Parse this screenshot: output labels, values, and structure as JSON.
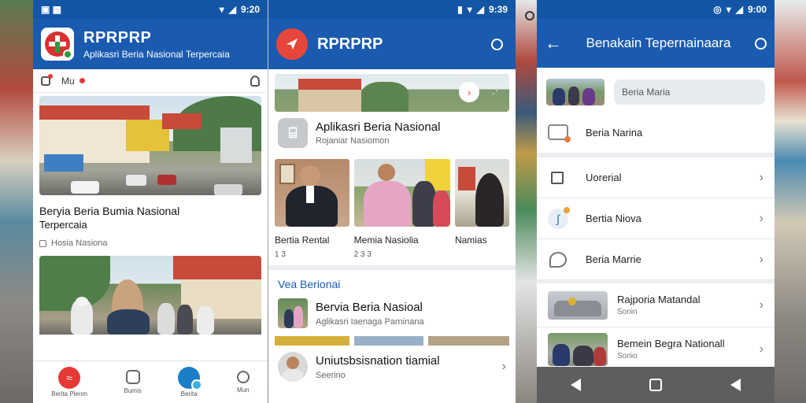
{
  "status": {
    "left_icons": "▣ ▩",
    "time1": "9:20",
    "time2": "9:39",
    "time3": "9:00"
  },
  "screen1": {
    "app_name": "RPRPRP",
    "app_tagline": "Aplikasri Beria Nasional Terpercaia",
    "tab_label": "Mu",
    "card1_title": "Beryia Beria Bumia Nasional",
    "card1_subtitle": "Terpercaia",
    "card1_meta": "Hosia Nasiona",
    "bottom_nav": [
      "Berita Plenm",
      "Bumis",
      "Berita",
      "Mun"
    ]
  },
  "screen2": {
    "app_name": "RPRPRP",
    "feature_title": "Aplikasri Beria Nasional",
    "feature_sub": "Rojaniar Nasiomon",
    "gallery": [
      {
        "title": "Bertia Rental",
        "meta": "1 3"
      },
      {
        "title": "Memia Nasiolia",
        "meta": "2 3 3"
      },
      {
        "title": "Namias",
        "meta": ""
      }
    ],
    "section_label": "Vea Berionai",
    "items": [
      {
        "title": "Bervia Beria Nasioal",
        "sub": "Aglikasri Iaenaga Parninana"
      },
      {
        "title": "Uniutsbsisnation tiamial",
        "sub": "Seerino"
      }
    ]
  },
  "screen3": {
    "title": "Benakain Tepernainaara",
    "items": [
      {
        "label": "Beria Maria"
      },
      {
        "label": "Beria Narina"
      },
      {
        "label": "Uorerial"
      },
      {
        "label": "Bertia Niova"
      },
      {
        "label": "Beria Marrie"
      },
      {
        "label": "Rajporia Matandal",
        "sub": "Sonin"
      },
      {
        "label": "Bemein Begra Nationall",
        "sub": "Sonio"
      }
    ]
  },
  "colors": {
    "appbar": "#1a5bb0",
    "status": "#1356a6",
    "accent": "#e53935"
  },
  "icons": [
    "search-icon",
    "back-icon",
    "chevron-right-icon",
    "play-icon",
    "home-icon",
    "square-icon",
    "back-triangle-icon"
  ]
}
